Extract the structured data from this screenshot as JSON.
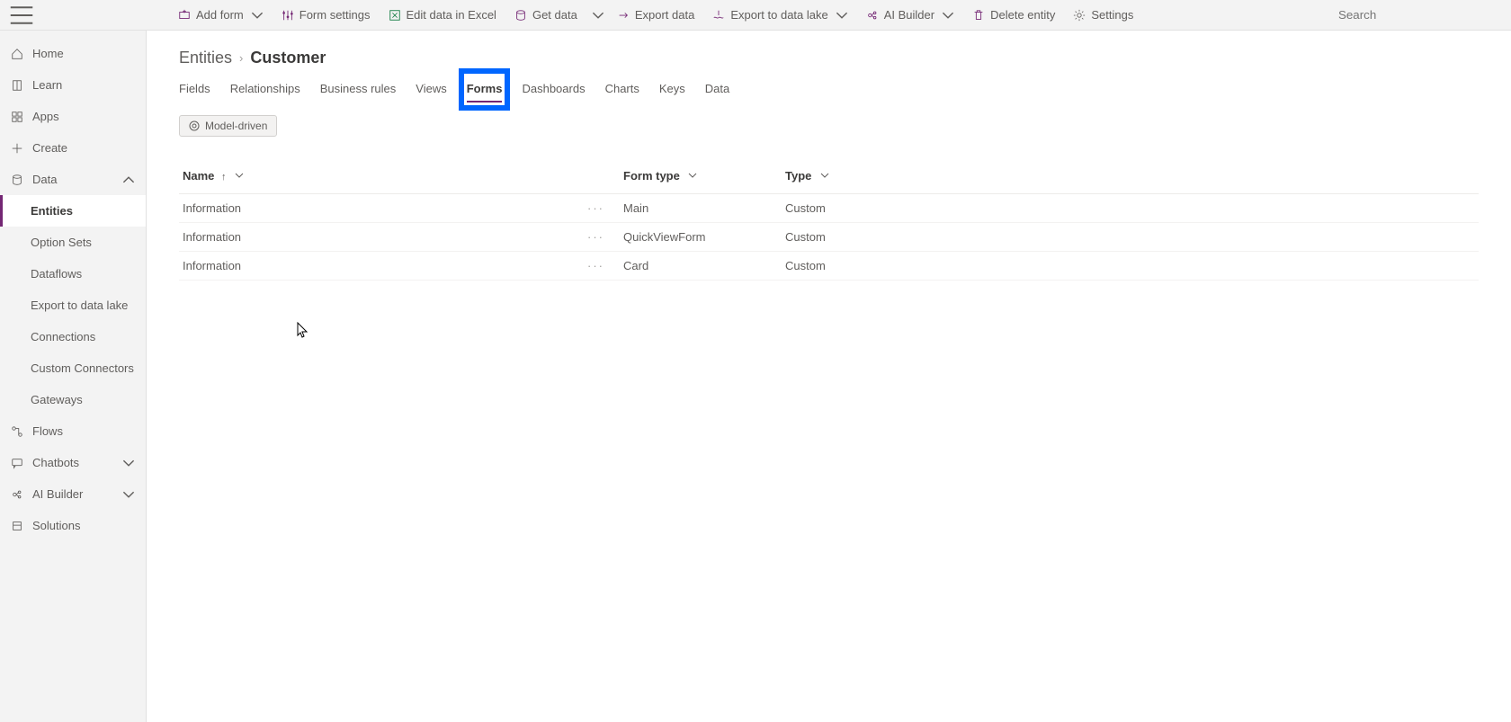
{
  "toolbar": {
    "addForm": "Add form",
    "formSettings": "Form settings",
    "editExcel": "Edit data in Excel",
    "getData": "Get data",
    "exportData": "Export data",
    "exportLake": "Export to data lake",
    "aiBuilder": "AI Builder",
    "deleteEntity": "Delete entity",
    "settings": "Settings",
    "searchPlaceholder": "Search"
  },
  "sidebar": {
    "home": "Home",
    "learn": "Learn",
    "apps": "Apps",
    "create": "Create",
    "data": "Data",
    "entities": "Entities",
    "optionSets": "Option Sets",
    "dataflows": "Dataflows",
    "exportLake": "Export to data lake",
    "connections": "Connections",
    "customConnectors": "Custom Connectors",
    "gateways": "Gateways",
    "flows": "Flows",
    "chatbots": "Chatbots",
    "aiBuilder": "AI Builder",
    "solutions": "Solutions"
  },
  "breadcrumb": {
    "root": "Entities",
    "leaf": "Customer"
  },
  "tabs": {
    "fields": "Fields",
    "relationships": "Relationships",
    "businessRules": "Business rules",
    "views": "Views",
    "forms": "Forms",
    "dashboards": "Dashboards",
    "charts": "Charts",
    "keys": "Keys",
    "data": "Data"
  },
  "badge": "Model-driven",
  "columns": {
    "name": "Name",
    "formType": "Form type",
    "type": "Type"
  },
  "rows": [
    {
      "name": "Information",
      "formType": "Main",
      "type": "Custom"
    },
    {
      "name": "Information",
      "formType": "QuickViewForm",
      "type": "Custom"
    },
    {
      "name": "Information",
      "formType": "Card",
      "type": "Custom"
    }
  ]
}
